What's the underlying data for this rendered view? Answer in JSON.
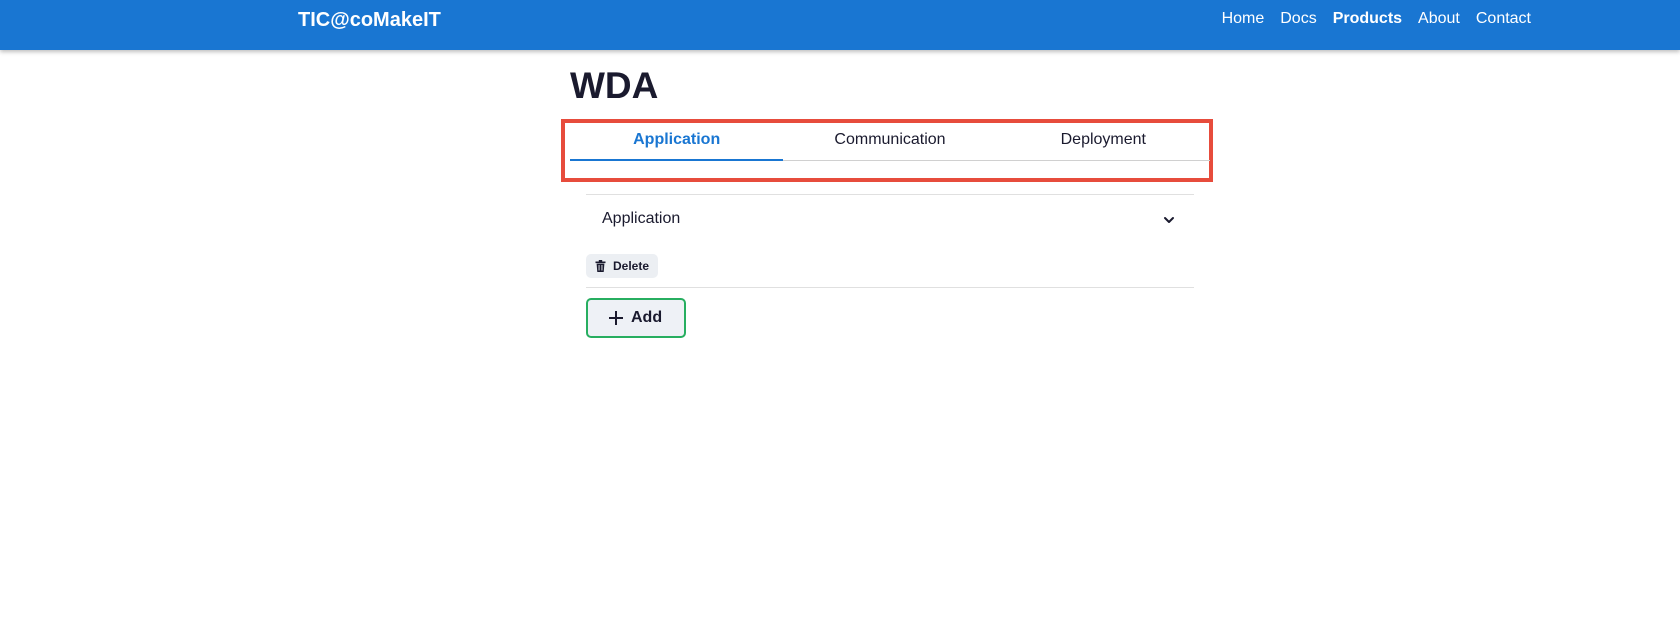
{
  "navbar": {
    "brand": "TIC@coMakeIT",
    "links": [
      {
        "label": "Home"
      },
      {
        "label": "Docs"
      },
      {
        "label": "Products"
      },
      {
        "label": "About"
      },
      {
        "label": "Contact"
      }
    ],
    "active_link": "Products",
    "color": "#1976d2"
  },
  "page": {
    "title": "WDA"
  },
  "tabs": [
    {
      "label": "Application"
    },
    {
      "label": "Communication"
    },
    {
      "label": "Deployment"
    }
  ],
  "active_tab": "Application",
  "accordion": {
    "title": "Application",
    "icon": "chevron-down-icon",
    "delete_label": "Delete",
    "delete_icon": "trash-icon"
  },
  "actions": {
    "add_label": "Add",
    "add_icon": "plus-icon"
  },
  "colors": {
    "accent": "#1976d2",
    "highlight": "#e74c3c",
    "add_border": "#27ae60"
  }
}
